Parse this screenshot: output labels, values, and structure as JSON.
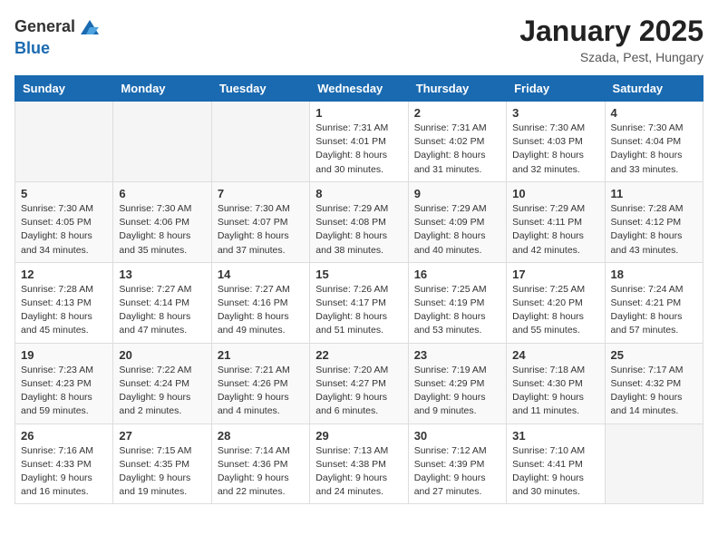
{
  "header": {
    "logo_general": "General",
    "logo_blue": "Blue",
    "month_title": "January 2025",
    "location": "Szada, Pest, Hungary"
  },
  "weekdays": [
    "Sunday",
    "Monday",
    "Tuesday",
    "Wednesday",
    "Thursday",
    "Friday",
    "Saturday"
  ],
  "weeks": [
    [
      {
        "day": "",
        "info": ""
      },
      {
        "day": "",
        "info": ""
      },
      {
        "day": "",
        "info": ""
      },
      {
        "day": "1",
        "info": "Sunrise: 7:31 AM\nSunset: 4:01 PM\nDaylight: 8 hours\nand 30 minutes."
      },
      {
        "day": "2",
        "info": "Sunrise: 7:31 AM\nSunset: 4:02 PM\nDaylight: 8 hours\nand 31 minutes."
      },
      {
        "day": "3",
        "info": "Sunrise: 7:30 AM\nSunset: 4:03 PM\nDaylight: 8 hours\nand 32 minutes."
      },
      {
        "day": "4",
        "info": "Sunrise: 7:30 AM\nSunset: 4:04 PM\nDaylight: 8 hours\nand 33 minutes."
      }
    ],
    [
      {
        "day": "5",
        "info": "Sunrise: 7:30 AM\nSunset: 4:05 PM\nDaylight: 8 hours\nand 34 minutes."
      },
      {
        "day": "6",
        "info": "Sunrise: 7:30 AM\nSunset: 4:06 PM\nDaylight: 8 hours\nand 35 minutes."
      },
      {
        "day": "7",
        "info": "Sunrise: 7:30 AM\nSunset: 4:07 PM\nDaylight: 8 hours\nand 37 minutes."
      },
      {
        "day": "8",
        "info": "Sunrise: 7:29 AM\nSunset: 4:08 PM\nDaylight: 8 hours\nand 38 minutes."
      },
      {
        "day": "9",
        "info": "Sunrise: 7:29 AM\nSunset: 4:09 PM\nDaylight: 8 hours\nand 40 minutes."
      },
      {
        "day": "10",
        "info": "Sunrise: 7:29 AM\nSunset: 4:11 PM\nDaylight: 8 hours\nand 42 minutes."
      },
      {
        "day": "11",
        "info": "Sunrise: 7:28 AM\nSunset: 4:12 PM\nDaylight: 8 hours\nand 43 minutes."
      }
    ],
    [
      {
        "day": "12",
        "info": "Sunrise: 7:28 AM\nSunset: 4:13 PM\nDaylight: 8 hours\nand 45 minutes."
      },
      {
        "day": "13",
        "info": "Sunrise: 7:27 AM\nSunset: 4:14 PM\nDaylight: 8 hours\nand 47 minutes."
      },
      {
        "day": "14",
        "info": "Sunrise: 7:27 AM\nSunset: 4:16 PM\nDaylight: 8 hours\nand 49 minutes."
      },
      {
        "day": "15",
        "info": "Sunrise: 7:26 AM\nSunset: 4:17 PM\nDaylight: 8 hours\nand 51 minutes."
      },
      {
        "day": "16",
        "info": "Sunrise: 7:25 AM\nSunset: 4:19 PM\nDaylight: 8 hours\nand 53 minutes."
      },
      {
        "day": "17",
        "info": "Sunrise: 7:25 AM\nSunset: 4:20 PM\nDaylight: 8 hours\nand 55 minutes."
      },
      {
        "day": "18",
        "info": "Sunrise: 7:24 AM\nSunset: 4:21 PM\nDaylight: 8 hours\nand 57 minutes."
      }
    ],
    [
      {
        "day": "19",
        "info": "Sunrise: 7:23 AM\nSunset: 4:23 PM\nDaylight: 8 hours\nand 59 minutes."
      },
      {
        "day": "20",
        "info": "Sunrise: 7:22 AM\nSunset: 4:24 PM\nDaylight: 9 hours\nand 2 minutes."
      },
      {
        "day": "21",
        "info": "Sunrise: 7:21 AM\nSunset: 4:26 PM\nDaylight: 9 hours\nand 4 minutes."
      },
      {
        "day": "22",
        "info": "Sunrise: 7:20 AM\nSunset: 4:27 PM\nDaylight: 9 hours\nand 6 minutes."
      },
      {
        "day": "23",
        "info": "Sunrise: 7:19 AM\nSunset: 4:29 PM\nDaylight: 9 hours\nand 9 minutes."
      },
      {
        "day": "24",
        "info": "Sunrise: 7:18 AM\nSunset: 4:30 PM\nDaylight: 9 hours\nand 11 minutes."
      },
      {
        "day": "25",
        "info": "Sunrise: 7:17 AM\nSunset: 4:32 PM\nDaylight: 9 hours\nand 14 minutes."
      }
    ],
    [
      {
        "day": "26",
        "info": "Sunrise: 7:16 AM\nSunset: 4:33 PM\nDaylight: 9 hours\nand 16 minutes."
      },
      {
        "day": "27",
        "info": "Sunrise: 7:15 AM\nSunset: 4:35 PM\nDaylight: 9 hours\nand 19 minutes."
      },
      {
        "day": "28",
        "info": "Sunrise: 7:14 AM\nSunset: 4:36 PM\nDaylight: 9 hours\nand 22 minutes."
      },
      {
        "day": "29",
        "info": "Sunrise: 7:13 AM\nSunset: 4:38 PM\nDaylight: 9 hours\nand 24 minutes."
      },
      {
        "day": "30",
        "info": "Sunrise: 7:12 AM\nSunset: 4:39 PM\nDaylight: 9 hours\nand 27 minutes."
      },
      {
        "day": "31",
        "info": "Sunrise: 7:10 AM\nSunset: 4:41 PM\nDaylight: 9 hours\nand 30 minutes."
      },
      {
        "day": "",
        "info": ""
      }
    ]
  ]
}
